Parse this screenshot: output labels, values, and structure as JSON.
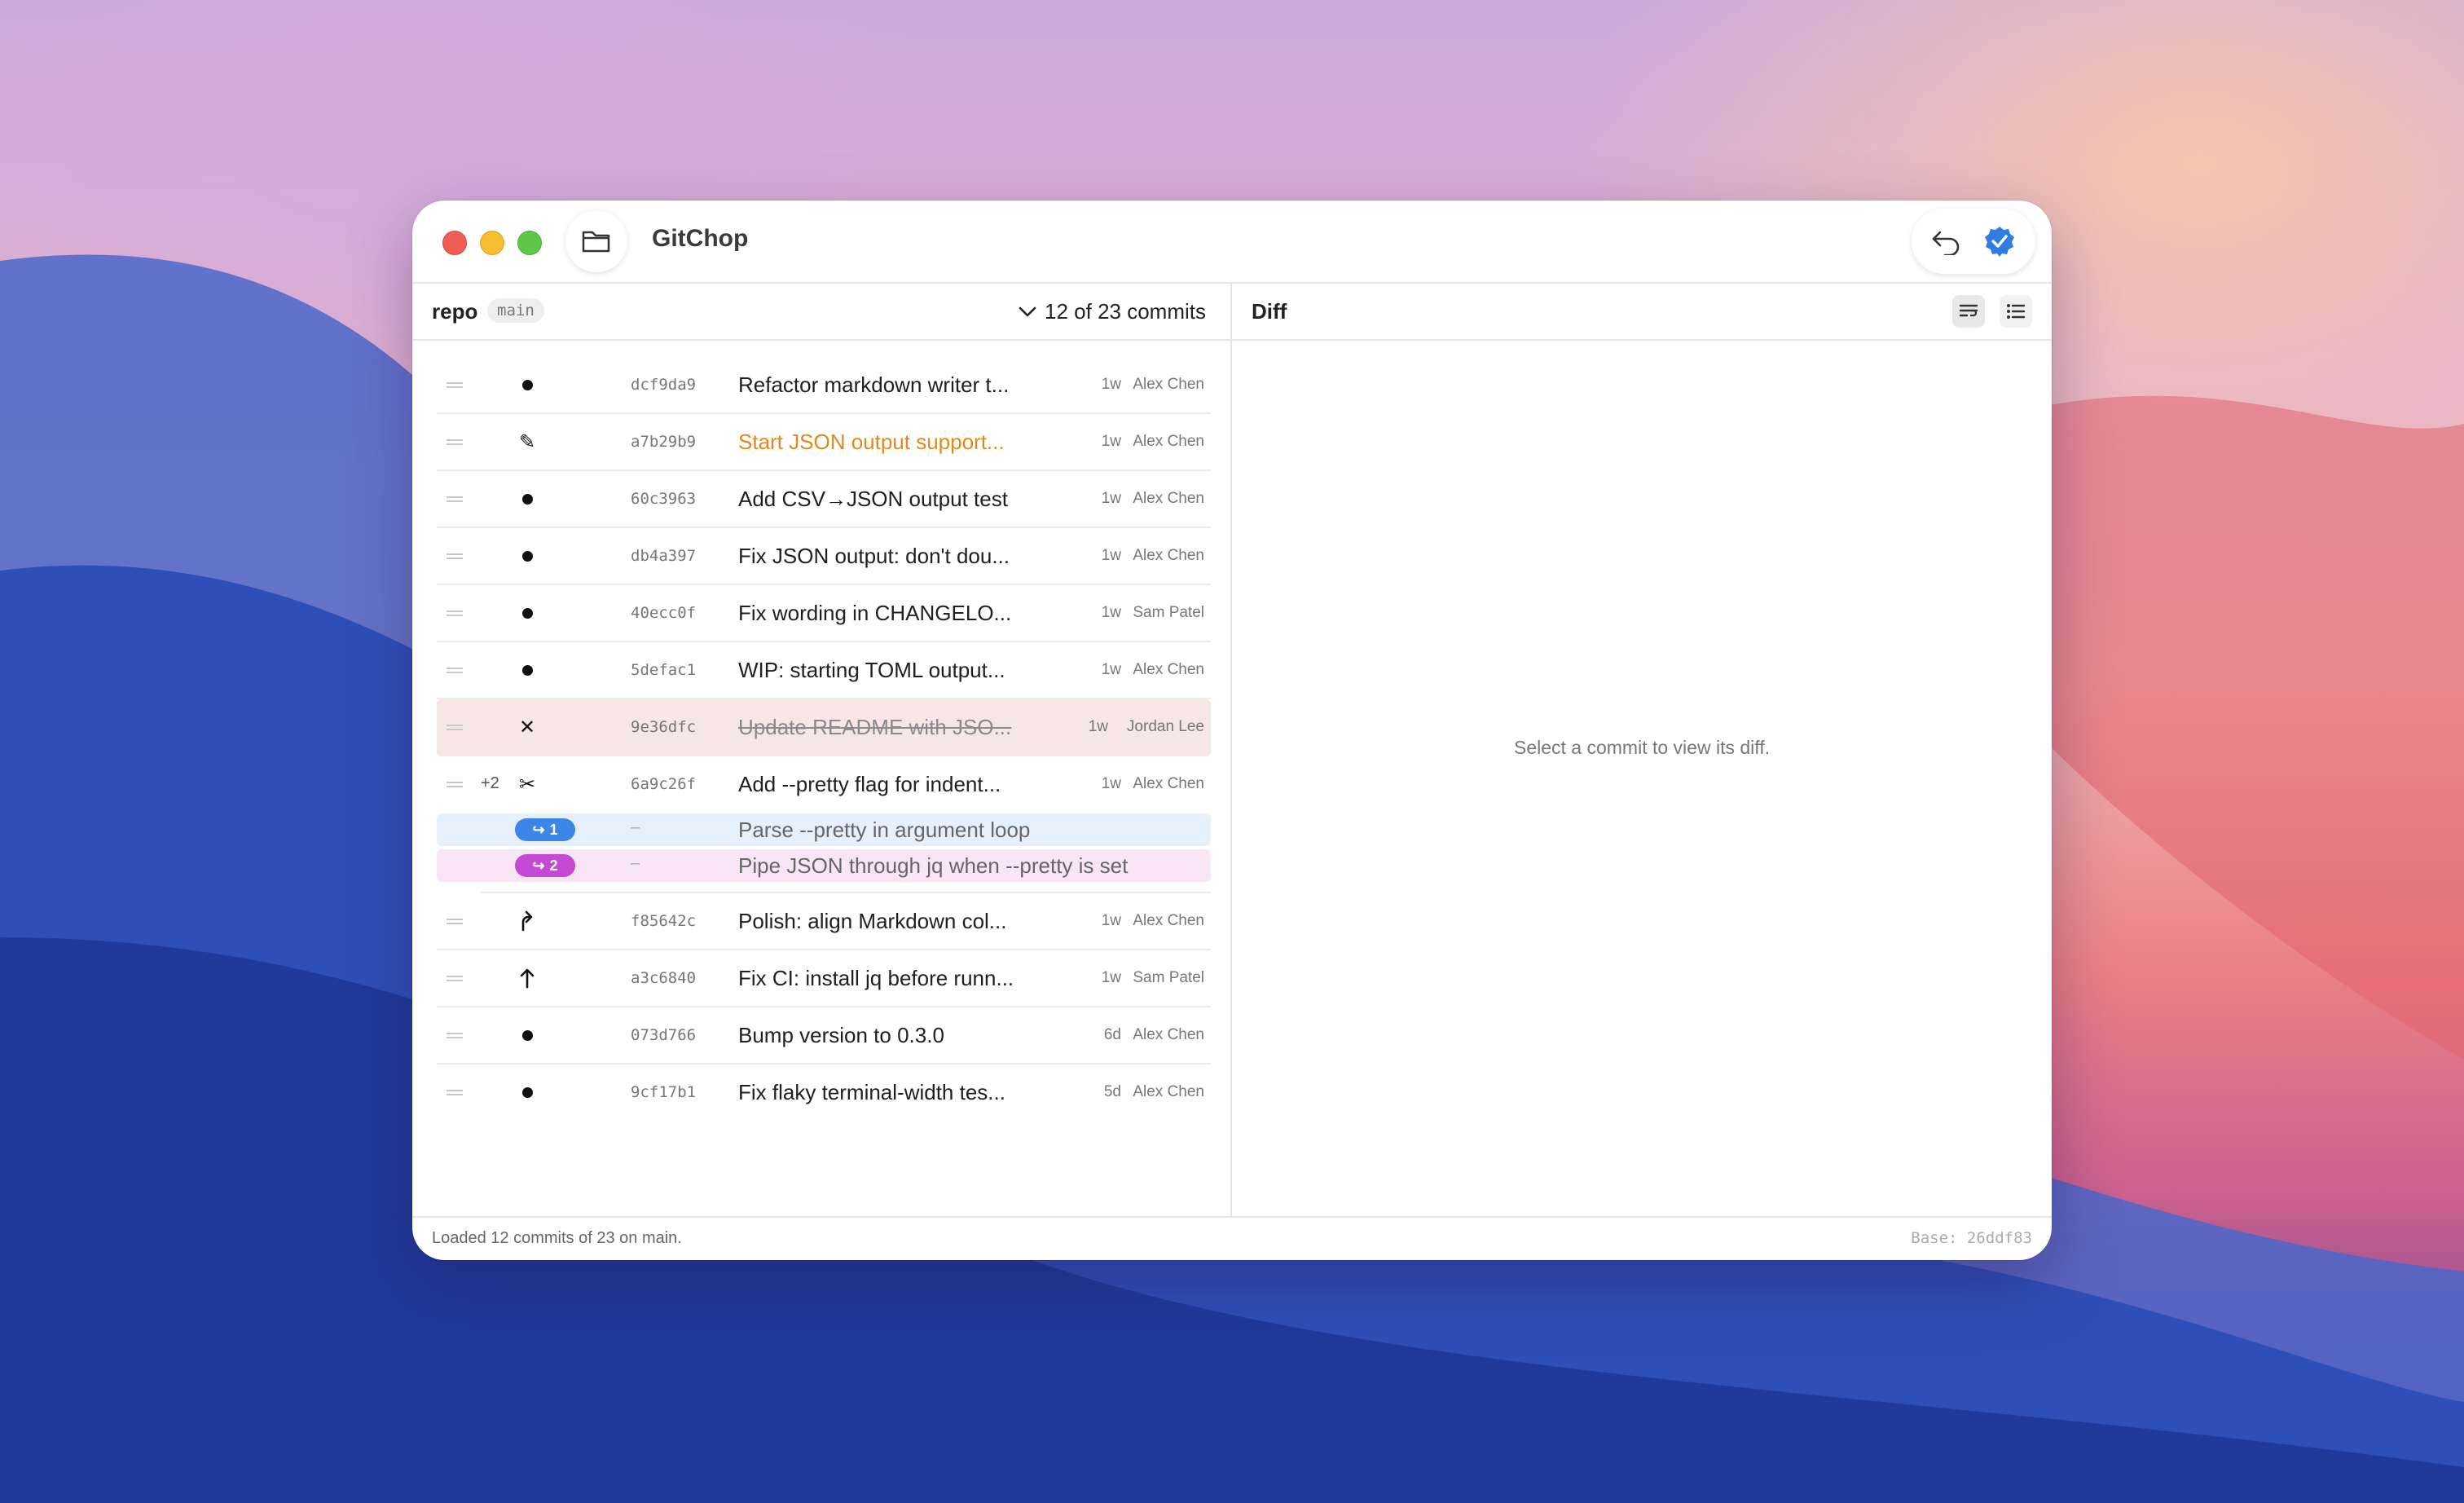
{
  "window": {
    "title": "GitChop"
  },
  "left_pane": {
    "repo_label": "repo",
    "branch": "main",
    "commit_count": "12 of 23 commits"
  },
  "right_pane": {
    "title": "Diff",
    "empty_message": "Select a commit to view its diff."
  },
  "commits": [
    {
      "hash": "dcf9da9",
      "message": "Refactor markdown writer t...",
      "age": "1w",
      "author": "Alex Chen",
      "action_icon": "pick-dot"
    },
    {
      "hash": "a7b29b9",
      "message": "Start JSON output support...",
      "age": "1w",
      "author": "Alex Chen",
      "action_icon": "edit-pencil"
    },
    {
      "hash": "60c3963",
      "message": "Add CSV→JSON output test",
      "age": "1w",
      "author": "Alex Chen",
      "action_icon": "pick-dot"
    },
    {
      "hash": "db4a397",
      "message": "Fix JSON output: don't dou...",
      "age": "1w",
      "author": "Alex Chen",
      "action_icon": "pick-dot"
    },
    {
      "hash": "40ecc0f",
      "message": "Fix wording in CHANGELO...",
      "age": "1w",
      "author": "Sam Patel",
      "action_icon": "pick-dot"
    },
    {
      "hash": "5defac1",
      "message": "WIP: starting TOML output...",
      "age": "1w",
      "author": "Alex Chen",
      "action_icon": "pick-dot"
    },
    {
      "hash": "9e36dfc",
      "message": "Update README with JSO...",
      "age": "1w",
      "author": "Jordan Lee",
      "action_icon": "drop-x"
    },
    {
      "hash": "6a9c26f",
      "message": "Add --pretty flag for indent...",
      "age": "1w",
      "author": "Alex Chen",
      "action_icon": "split-scissors",
      "extra": "+2",
      "splits": [
        {
          "badge": "1",
          "dash": "–",
          "message": "Parse --pretty in argument loop"
        },
        {
          "badge": "2",
          "dash": "–",
          "message": "Pipe JSON through jq when --pretty is set"
        }
      ]
    },
    {
      "hash": "f85642c",
      "message": "Polish: align Markdown col...",
      "age": "1w",
      "author": "Alex Chen",
      "action_icon": "fixup-arrow"
    },
    {
      "hash": "a3c6840",
      "message": "Fix CI: install jq before runn...",
      "age": "1w",
      "author": "Sam Patel",
      "action_icon": "squash-arrow"
    },
    {
      "hash": "073d766",
      "message": "Bump version to 0.3.0",
      "age": "6d",
      "author": "Alex Chen",
      "action_icon": "pick-dot"
    },
    {
      "hash": "9cf17b1",
      "message": "Fix flaky terminal-width tes...",
      "age": "5d",
      "author": "Alex Chen",
      "action_icon": "pick-dot"
    }
  ],
  "status": {
    "text": "Loaded 12 commits of 23 on main.",
    "base": "Base: 26ddf83"
  },
  "colors": {
    "accent_blue": "#3d86e8",
    "split_pink": "#c44ad6",
    "edit_orange": "#e08a1e",
    "drop_row": "#f6e6e4"
  }
}
